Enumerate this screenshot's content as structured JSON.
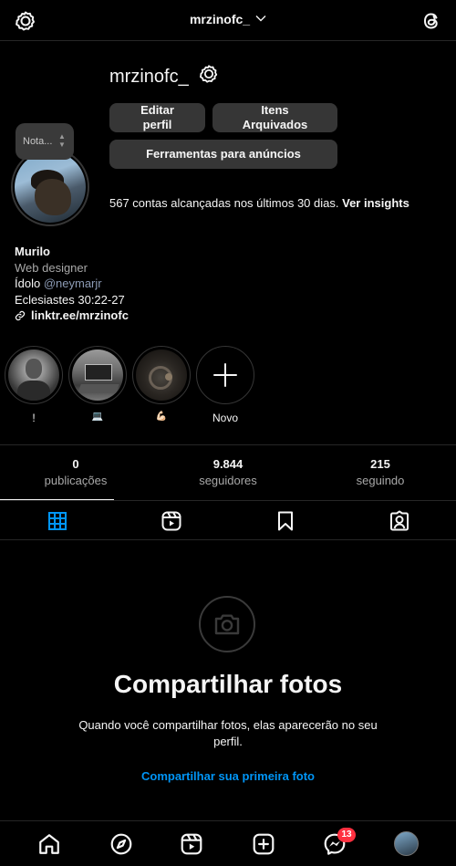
{
  "topbar": {
    "username": "mrzinofc_",
    "settings_icon": "gear-icon",
    "threads_icon": "threads-icon"
  },
  "profile": {
    "username": "mrzinofc_",
    "note_placeholder": "Nota...",
    "buttons": {
      "edit_line1": "Editar",
      "edit_line2": "perfil",
      "archive_line1": "Itens",
      "archive_line2": "Arquivados",
      "ads": "Ferramentas para anúncios"
    },
    "reach_text": "567 contas alcançadas nos últimos 30 dias.",
    "reach_link": "Ver insights"
  },
  "bio": {
    "name": "Murilo",
    "category": "Web designer",
    "idol_prefix": "Ídolo",
    "idol_mention": "@neymarjr",
    "verse": "Eclesiastes 30:22-27",
    "link": "linktr.ee/mrzinofc"
  },
  "highlights": [
    {
      "label": "!"
    },
    {
      "label": "💻"
    },
    {
      "label": "💪🏻"
    },
    {
      "label": "Novo"
    }
  ],
  "stats": {
    "posts_num": "0",
    "posts_label": "publicações",
    "followers_num": "9.844",
    "followers_label": "seguidores",
    "following_num": "215",
    "following_label": "seguindo"
  },
  "tabs": [
    "grid-icon",
    "reels-icon",
    "saved-icon",
    "tagged-icon"
  ],
  "empty": {
    "title": "Compartilhar fotos",
    "subtitle_line1": "Quando você compartilhar fotos, elas aparecerão no seu",
    "subtitle_line2": "perfil.",
    "cta": "Compartilhar sua primeira foto"
  },
  "bottomnav": {
    "messages_badge": "13"
  },
  "colors": {
    "background": "#000000",
    "button": "#363636",
    "accent_link": "#0095f6",
    "badge": "#ff3040",
    "active_tab": "#0095f6"
  }
}
